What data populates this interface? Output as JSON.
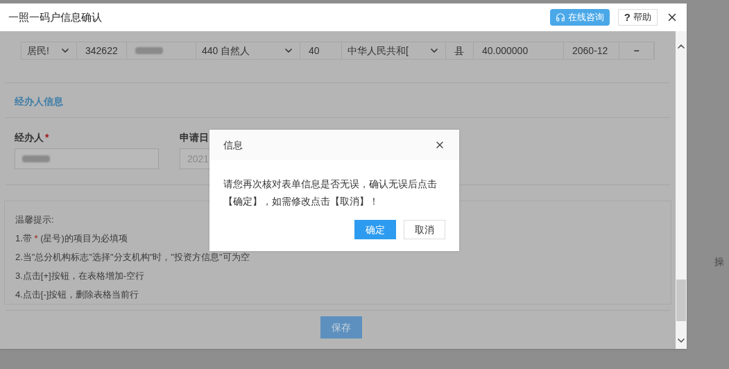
{
  "window": {
    "title": "一照一码户信息确认",
    "consult_button": "在线咨询",
    "help_icon": "?",
    "help_button": "帮助"
  },
  "table": {
    "rows": [
      {
        "cells": [
          {
            "kind": "select",
            "text": "居民!"
          },
          {
            "kind": "text",
            "text": "342622"
          },
          {
            "kind": "blurred"
          },
          {
            "kind": "select",
            "text": "440 自然人"
          },
          {
            "kind": "text",
            "text": "40"
          },
          {
            "kind": "select",
            "text": "中华人民共和["
          },
          {
            "kind": "text",
            "text": "县"
          },
          {
            "kind": "text",
            "text": "40.000000"
          },
          {
            "kind": "text",
            "text": "2060-12"
          },
          {
            "kind": "action",
            "text": "−"
          }
        ]
      }
    ]
  },
  "operator_section": {
    "heading": "经办人信息",
    "fields": [
      {
        "label": "经办人",
        "required_mark": "*",
        "blurred": true
      },
      {
        "label": "申请日",
        "value": "2021",
        "blurred": false
      }
    ]
  },
  "tips": {
    "title": "温馨提示:",
    "lines": [
      {
        "text": "1.带 ",
        "mark": "*",
        "rest": " (星号)的项目为必填项"
      },
      {
        "text": "2.当\"总分机构标志\"选择\"分支机构\"时，\"投资方信息\"可为空"
      },
      {
        "text": "3.点击[+]按钮，在表格增加-空行"
      },
      {
        "text": "4.点击[-]按钮，删除表格当前行"
      }
    ]
  },
  "save_button": "保存",
  "background_page": {
    "column_label": "操"
  },
  "dialog": {
    "title": "信息",
    "message": "请您再次核对表单信息是否无误，确认无误后点击【确定】，如需修改点击【取消】！",
    "buttons": [
      {
        "label": "确定",
        "primary": true
      },
      {
        "label": "取消",
        "primary": false
      }
    ]
  }
}
